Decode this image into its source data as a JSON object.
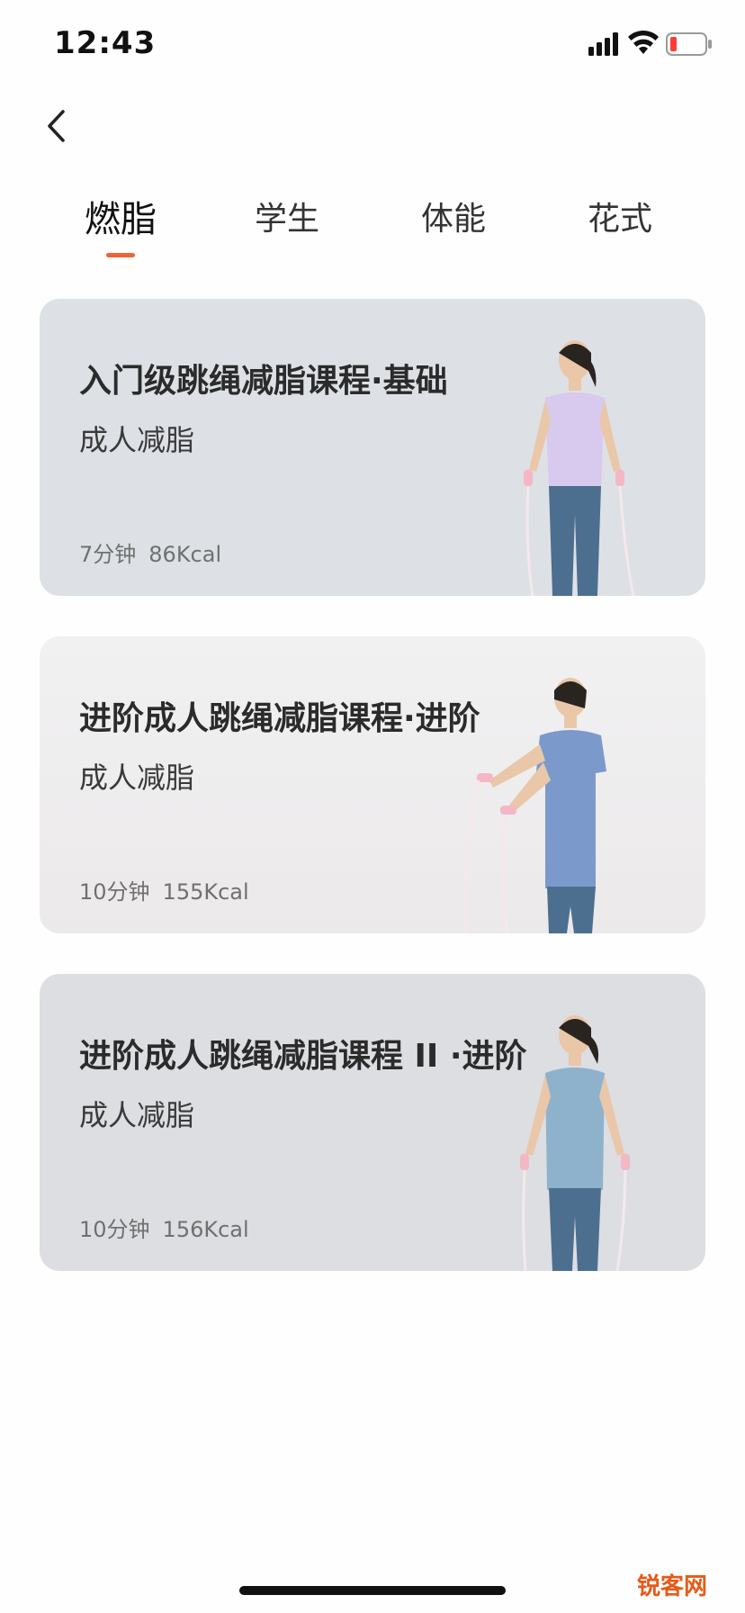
{
  "status_bar": {
    "time": "12:43",
    "icons": [
      "signal-icon",
      "wifi-icon",
      "battery-icon"
    ]
  },
  "nav": {
    "back_icon": "chevron-left-icon"
  },
  "tabs": [
    {
      "label": "燃脂",
      "active": true
    },
    {
      "label": "学生",
      "active": false
    },
    {
      "label": "体能",
      "active": false
    },
    {
      "label": "花式",
      "active": false
    }
  ],
  "colors": {
    "accent": "#f0643a",
    "watermark": "#e55a1a"
  },
  "courses": [
    {
      "title": "入门级跳绳减脂课程·基础",
      "subtitle": "成人减脂",
      "duration": "7分钟",
      "calories": "86Kcal"
    },
    {
      "title": "进阶成人跳绳减脂课程·进阶",
      "subtitle": "成人减脂",
      "duration": "10分钟",
      "calories": "155Kcal"
    },
    {
      "title": "进阶成人跳绳减脂课程 II ·进阶",
      "subtitle": "成人减脂",
      "duration": "10分钟",
      "calories": "156Kcal"
    }
  ],
  "watermark": "锐客网"
}
